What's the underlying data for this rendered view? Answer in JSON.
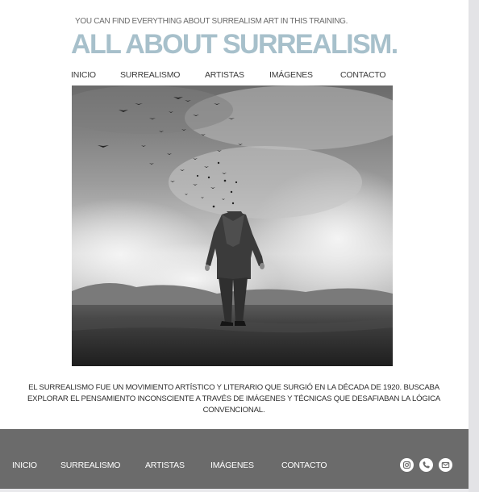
{
  "header": {
    "tagline": "YOU CAN FIND EVERYTHING ABOUT SURREALISM ART IN THIS TRAINING.",
    "title": "ALL ABOUT SURREALISM."
  },
  "nav": {
    "items": [
      "INICIO",
      "SURREALISMO",
      "ARTISTAS",
      "IMÁGENES",
      "CONTACTO"
    ]
  },
  "hero": {
    "image": "grayscale photo: headless man in a suit standing in a field, birds flying away from his collar, cloudy sky"
  },
  "description": {
    "text": "EL SURREALISMO FUE UN MOVIMIENTO ARTÍSTICO Y LITERARIO QUE SURGIÓ EN LA DÉCADA DE 1920. BUSCABA EXPLORAR EL PENSAMIENTO INCONSCIENTE A TRAVÉS DE IMÁGENES Y TÉCNICAS QUE DESAFIABAN LA LÓGICA CONVENCIONAL."
  },
  "footer": {
    "items": [
      "INICIO",
      "SURREALISMO",
      "ARTISTAS",
      "IMÁGENES",
      "CONTACTO"
    ],
    "social_icons": [
      "instagram-icon",
      "phone-icon",
      "mail-icon"
    ]
  },
  "colors": {
    "title": "#a7c0cb",
    "footer_bg": "#6b6b6b",
    "page_bg": "#ffffff"
  }
}
